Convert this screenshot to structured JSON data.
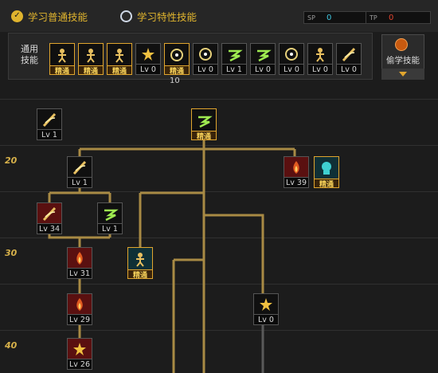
{
  "tabs": {
    "normal": "学习普通技能",
    "special": "学习特性技能"
  },
  "points": {
    "left_label": "SP",
    "left_value": "0",
    "right_label": "TP",
    "right_value": "0",
    "left_color": "#3fc6e0",
    "right_color": "#e0432e"
  },
  "common": {
    "label": "通用技能",
    "below_count": "10",
    "skills": [
      {
        "icon": "flex-icon",
        "level": "精通"
      },
      {
        "icon": "kick-icon",
        "level": "精通"
      },
      {
        "icon": "sprint-icon",
        "level": "精通"
      },
      {
        "icon": "wings-icon",
        "level": "Lv 0"
      },
      {
        "icon": "target-icon",
        "level": "精通"
      },
      {
        "icon": "crosshair-icon",
        "level": "Lv 0"
      },
      {
        "icon": "leap-icon",
        "level": "Lv 1"
      },
      {
        "icon": "summon-icon",
        "level": "Lv 0"
      },
      {
        "icon": "coin-icon",
        "level": "Lv 0"
      },
      {
        "icon": "armor-icon",
        "level": "Lv 0"
      },
      {
        "icon": "sword-icon",
        "level": "Lv 0"
      }
    ]
  },
  "steal": {
    "label": "偷学技能"
  },
  "rows": [
    "20",
    "30",
    "40"
  ],
  "tree": [
    {
      "id": "t1",
      "icon": "slash-icon",
      "level": "Lv 1"
    },
    {
      "id": "t2",
      "icon": "burst-icon",
      "level": "精通"
    },
    {
      "id": "t3",
      "icon": "crescent-icon",
      "level": "Lv 1"
    },
    {
      "id": "t4",
      "icon": "flame-blade-icon",
      "level": "Lv 39"
    },
    {
      "id": "t5",
      "icon": "skull-icon",
      "level": "精通"
    },
    {
      "id": "t6",
      "icon": "whirl-icon",
      "level": "Lv 34"
    },
    {
      "id": "t7",
      "icon": "claw-icon",
      "level": "Lv 1"
    },
    {
      "id": "t8",
      "icon": "fist-icon",
      "level": "精通"
    },
    {
      "id": "t9",
      "icon": "fire-slash-icon",
      "level": "Lv 31"
    },
    {
      "id": "t10",
      "icon": "explosion-icon",
      "level": "Lv 0"
    },
    {
      "id": "t11",
      "icon": "red-wave-icon",
      "level": "Lv 29"
    },
    {
      "id": "t12",
      "icon": "spark-icon",
      "level": "Lv 26"
    }
  ]
}
